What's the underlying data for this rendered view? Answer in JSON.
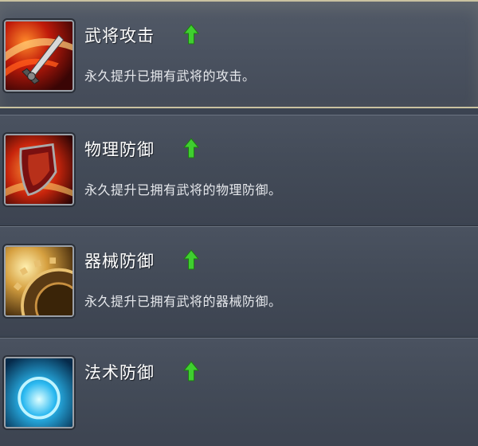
{
  "skills": [
    {
      "title": "武将攻击",
      "description": "永久提升已拥有武将的攻击。",
      "icon": "sword-strike-icon",
      "trend": "up"
    },
    {
      "title": "物理防御",
      "description": "永久提升已拥有武将的物理防御。",
      "icon": "shield-icon",
      "trend": "up"
    },
    {
      "title": "器械防御",
      "description": "永久提升已拥有武将的器械防御。",
      "icon": "gear-wheel-icon",
      "trend": "up"
    },
    {
      "title": "法术防御",
      "description": "",
      "icon": "magic-orb-icon",
      "trend": "up"
    }
  ],
  "colors": {
    "arrow_up": "#3fcf2f",
    "highlight_border": "#c9c2a0",
    "text": "#ffffff"
  }
}
